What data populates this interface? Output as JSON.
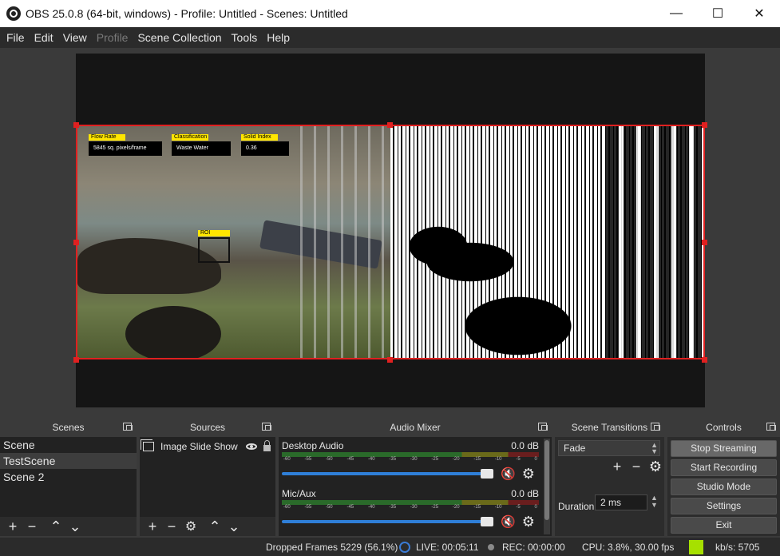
{
  "window": {
    "title": "OBS 25.0.8 (64-bit, windows) - Profile: Untitled - Scenes: Untitled",
    "minimize": "—",
    "maximize": "☐",
    "close": "✕"
  },
  "menu": [
    "File",
    "Edit",
    "View",
    "Profile",
    "Scene Collection",
    "Tools",
    "Help"
  ],
  "preview": {
    "hud": [
      {
        "label": "Flow Rate",
        "value": "5845 sq. pixels/frame"
      },
      {
        "label": "Classification",
        "value": "Waste Water"
      },
      {
        "label": "Solid Index",
        "value": "0.36"
      }
    ],
    "roi_label": "ROI"
  },
  "scenes": {
    "title": "Scenes",
    "items": [
      "Scene",
      "TestScene",
      "Scene 2"
    ],
    "selected_index": 1
  },
  "sources": {
    "title": "Sources",
    "items": [
      {
        "name": "Image Slide Show"
      }
    ]
  },
  "mixer": {
    "title": "Audio Mixer",
    "ticks": [
      "-60",
      "-55",
      "-50",
      "-45",
      "-40",
      "-35",
      "-30",
      "-25",
      "-20",
      "-15",
      "-10",
      "-5",
      "0"
    ],
    "channels": [
      {
        "name": "Desktop Audio",
        "level": "0.0 dB",
        "volume": 1.0,
        "muted": true
      },
      {
        "name": "Mic/Aux",
        "level": "0.0 dB",
        "volume": 1.0,
        "muted": true
      }
    ]
  },
  "transitions": {
    "title": "Scene Transitions",
    "selected": "Fade",
    "duration_label": "Duration",
    "duration_value": "2 ms"
  },
  "controls": {
    "title": "Controls",
    "buttons": [
      "Stop Streaming",
      "Start Recording",
      "Studio Mode",
      "Settings",
      "Exit"
    ]
  },
  "status": {
    "dropped_frames": "Dropped Frames 5229 (56.1%)",
    "live": "LIVE: 00:05:11",
    "rec": "REC: 00:00:00",
    "cpu": "CPU: 3.8%, 30.00 fps",
    "kbps": "kb/s: 5705",
    "kbps_color": "#a6e000"
  },
  "colors": {
    "selection_border": "#e02020",
    "volume_slider": "#2f7fd8",
    "mute_icon": "#e02020"
  }
}
